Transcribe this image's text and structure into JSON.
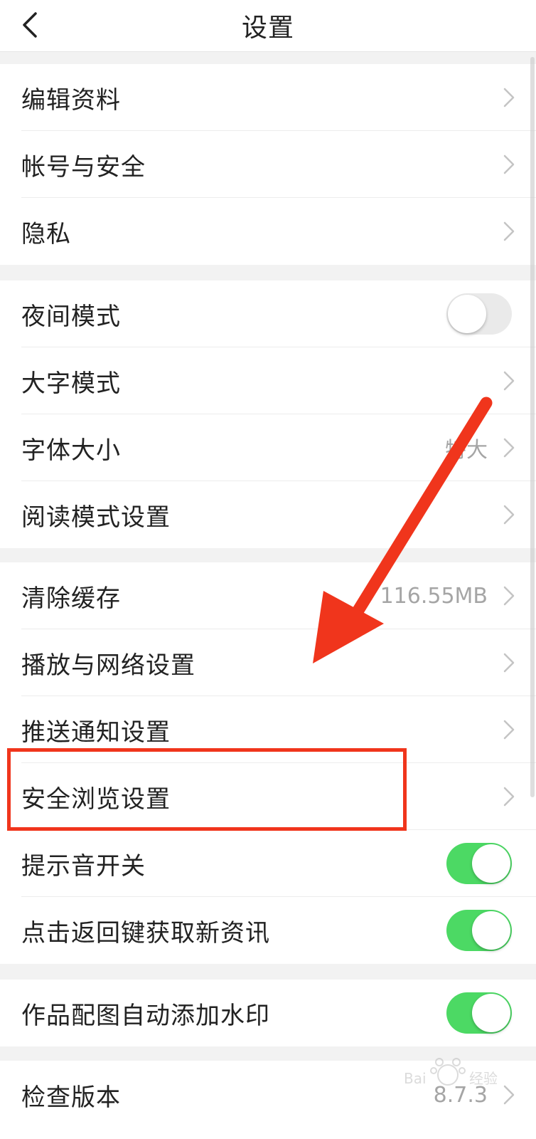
{
  "header": {
    "title": "设置"
  },
  "groups": [
    {
      "items": [
        {
          "label": "编辑资料"
        },
        {
          "label": "帐号与安全"
        },
        {
          "label": "隐私"
        }
      ]
    },
    {
      "items": [
        {
          "label": "夜间模式",
          "toggle": "off"
        },
        {
          "label": "大字模式"
        },
        {
          "label": "字体大小",
          "value": "特大"
        },
        {
          "label": "阅读模式设置"
        }
      ]
    },
    {
      "items": [
        {
          "label": "清除缓存",
          "value": "116.55MB"
        },
        {
          "label": "播放与网络设置"
        },
        {
          "label": "推送通知设置"
        },
        {
          "label": "安全浏览设置"
        },
        {
          "label": "提示音开关",
          "toggle": "on"
        },
        {
          "label": "点击返回键获取新资讯",
          "toggle": "on"
        }
      ]
    },
    {
      "items": [
        {
          "label": "作品配图自动添加水印",
          "toggle": "on"
        }
      ]
    },
    {
      "items": [
        {
          "label": "检查版本",
          "value": "8.7.3"
        }
      ]
    }
  ],
  "annotation": {
    "color": "#f0351c"
  },
  "toggle_colors": {
    "on": "#4cd964",
    "off": "#eaeaea"
  },
  "icons": {
    "back": "chevron-left-icon",
    "row": "chevron-right-icon"
  }
}
